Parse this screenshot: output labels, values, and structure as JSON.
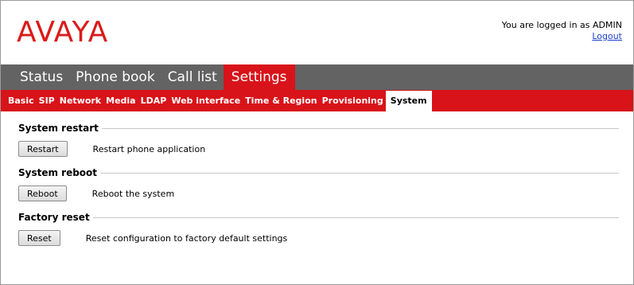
{
  "brand": {
    "logo_text": "AVAYA",
    "color": "#da1a1a"
  },
  "login": {
    "text": "You are logged in as ADMIN",
    "logout_label": "Logout"
  },
  "main_nav": [
    "Status",
    "Phone book",
    "Call list",
    "Settings"
  ],
  "main_nav_active": "Settings",
  "sub_nav": [
    "Basic",
    "SIP",
    "Network",
    "Media",
    "LDAP",
    "Web interface",
    "Time & Region",
    "Provisioning",
    "System"
  ],
  "sub_nav_active": "System",
  "sections": [
    {
      "title": "System restart",
      "button": "Restart",
      "description": "Restart phone application"
    },
    {
      "title": "System reboot",
      "button": "Reboot",
      "description": "Reboot the system"
    },
    {
      "title": "Factory reset",
      "button": "Reset",
      "description": "Reset configuration to factory default settings"
    }
  ],
  "colors": {
    "nav_gray": "#636363",
    "accent_red": "#d8131a",
    "link_blue": "#1a3fd0"
  }
}
